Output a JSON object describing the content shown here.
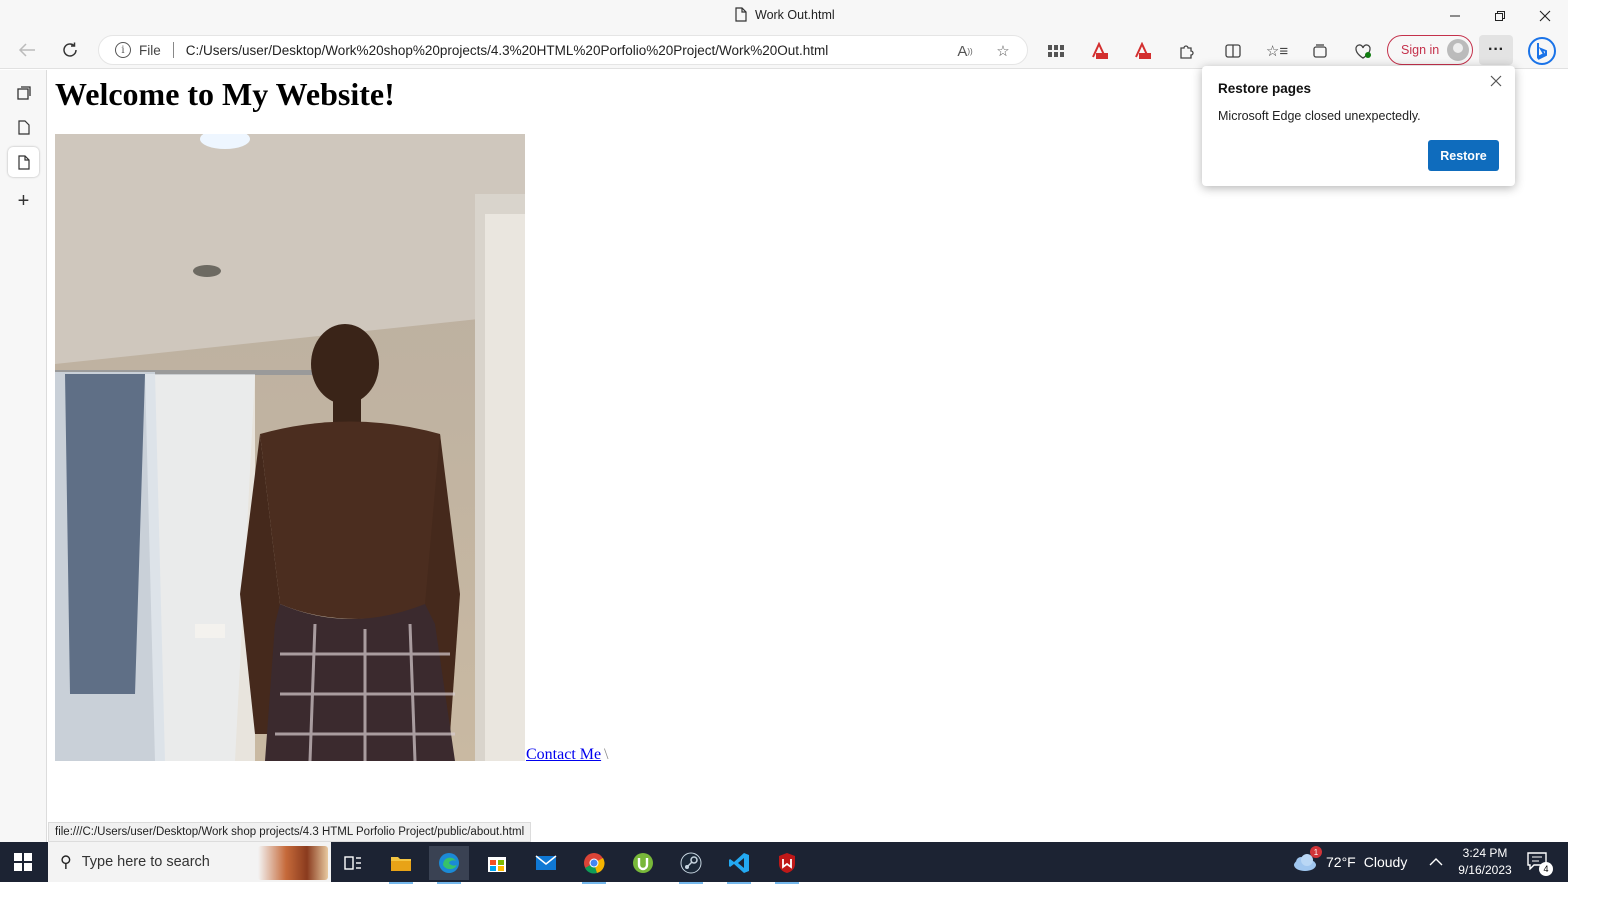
{
  "window": {
    "tab_title": "Work Out.html",
    "minimize_icon": "minimize-icon",
    "restore_icon": "restore-icon",
    "close_icon": "close-icon"
  },
  "toolbar": {
    "address_scheme": "File",
    "url": "C:/Users/user/Desktop/Work%20shop%20projects/4.3%20HTML%20Porfolio%20Project/Work%20Out.html",
    "sign_in_label": "Sign in"
  },
  "page": {
    "heading": "Welcome to My Website!",
    "contact_link": "Contact Me",
    "contact_tail": "\\"
  },
  "status_bar": {
    "hover_url": "file:///C:/Users/user/Desktop/Work shop projects/4.3 HTML Porfolio Project/public/about.html"
  },
  "restore_popup": {
    "title": "Restore pages",
    "message": "Microsoft Edge closed unexpectedly.",
    "button_label": "Restore"
  },
  "taskbar": {
    "search_placeholder": "Type here to search",
    "weather_temp": "72°F",
    "weather_desc": "Cloudy",
    "weather_badge": "1",
    "time": "3:24 PM",
    "date": "9/16/2023",
    "notification_count": "4",
    "accent_color": "#76b9ed"
  }
}
